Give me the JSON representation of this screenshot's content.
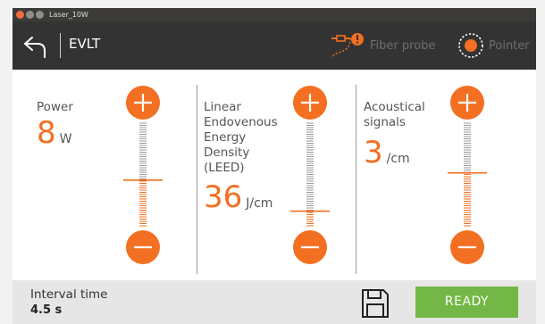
{
  "window": {
    "title": "Laser_10W"
  },
  "header": {
    "title": "EVLT",
    "fiber_probe_label": "Fiber probe",
    "pointer_label": "Pointer"
  },
  "panels": [
    {
      "label_lines": [
        "Power"
      ],
      "value": "8",
      "unit": "W",
      "slider_level": 0.45
    },
    {
      "label_lines": [
        "Linear",
        "Endovenous",
        "Energy",
        "Density",
        "(LEED)"
      ],
      "value": "36",
      "unit": "J/cm",
      "slider_level": 0.15
    },
    {
      "label_lines": [
        "Acoustical",
        "signals"
      ],
      "value": "3",
      "unit": "/cm",
      "slider_level": 0.52
    }
  ],
  "footer": {
    "interval_label": "Interval time",
    "interval_value": "4.5 s",
    "ready_label": "READY"
  },
  "colors": {
    "accent": "#f36f21",
    "header_bg": "#333333",
    "ready": "#73b846",
    "footer_bg": "#e6e6e6",
    "warning": "#f36f21"
  },
  "icons": [
    "back-arrow-icon",
    "fiber-probe-icon",
    "warning-icon",
    "pointer-icon",
    "plus-icon",
    "minus-icon",
    "save-icon"
  ]
}
